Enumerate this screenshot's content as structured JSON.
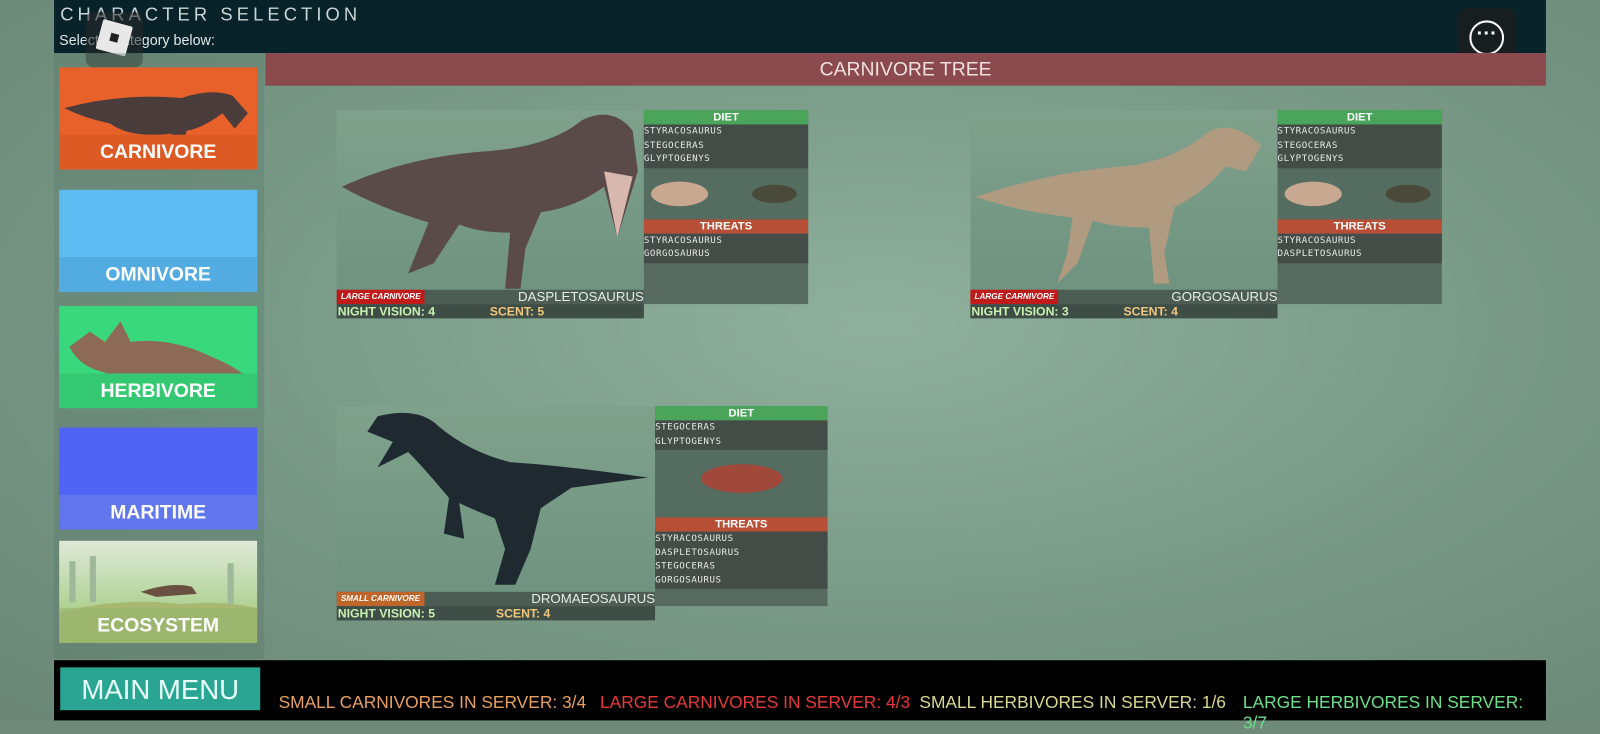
{
  "header": {
    "title": "CHARACTER SELECTION",
    "subtitle": "Select a category below:"
  },
  "tree_title": "CARNIVORE TREE",
  "categories": [
    {
      "label": "CARNIVORE",
      "color": "#e8602a"
    },
    {
      "label": "OMNIVORE",
      "color": "#5cbcf2"
    },
    {
      "label": "HERBIVORE",
      "color": "#3ad87c"
    },
    {
      "label": "MARITIME",
      "color": "#4f64f4"
    },
    {
      "label": "ECOSYSTEM",
      "color": "#b9d7a0"
    }
  ],
  "dinos": [
    {
      "name": "DASPLETOSAURUS",
      "class": "LARGE CARNIVORE",
      "night_vision": "NIGHT VISION: 4",
      "scent": "SCENT: 5",
      "diet_label": "DIET",
      "diet": [
        "STYRACOSAURUS",
        "STEGOCERAS",
        "GLYPTOGENYS"
      ],
      "threats_label": "THREATS",
      "threats": [
        "STYRACOSAURUS",
        "GORGOSAURUS"
      ]
    },
    {
      "name": "GORGOSAURUS",
      "class": "LARGE CARNIVORE",
      "night_vision": "NIGHT VISION: 3",
      "scent": "SCENT: 4",
      "diet_label": "DIET",
      "diet": [
        "STYRACOSAURUS",
        "STEGOCERAS",
        "GLYPTOGENYS"
      ],
      "threats_label": "THREATS",
      "threats": [
        "STYRACOSAURUS",
        "DASPLETOSAURUS"
      ]
    },
    {
      "name": "DROMAEOSAURUS",
      "class": "SMALL CARNIVORE",
      "night_vision": "NIGHT VISION: 5",
      "scent": "SCENT: 4",
      "diet_label": "DIET",
      "diet": [
        "STEGOCERAS",
        "GLYPTOGENYS"
      ],
      "threats_label": "THREATS",
      "threats": [
        "STYRACOSAURUS",
        "DASPLETOSAURUS",
        "STEGOCERAS",
        "GORGOSAURUS"
      ]
    }
  ],
  "footer": {
    "main_menu": "MAIN MENU",
    "counts": [
      {
        "text": "SMALL CARNIVORES IN SERVER: 3/4",
        "color": "#e8a060"
      },
      {
        "text": "LARGE CARNIVORES IN SERVER: 4/3",
        "color": "#e83a3a"
      },
      {
        "text": "SMALL HERBIVORES IN SERVER: 1/6",
        "color": "#d8d890"
      },
      {
        "text": "LARGE HERBIVORES IN SERVER: 3/7",
        "color": "#6ee08a"
      }
    ]
  }
}
